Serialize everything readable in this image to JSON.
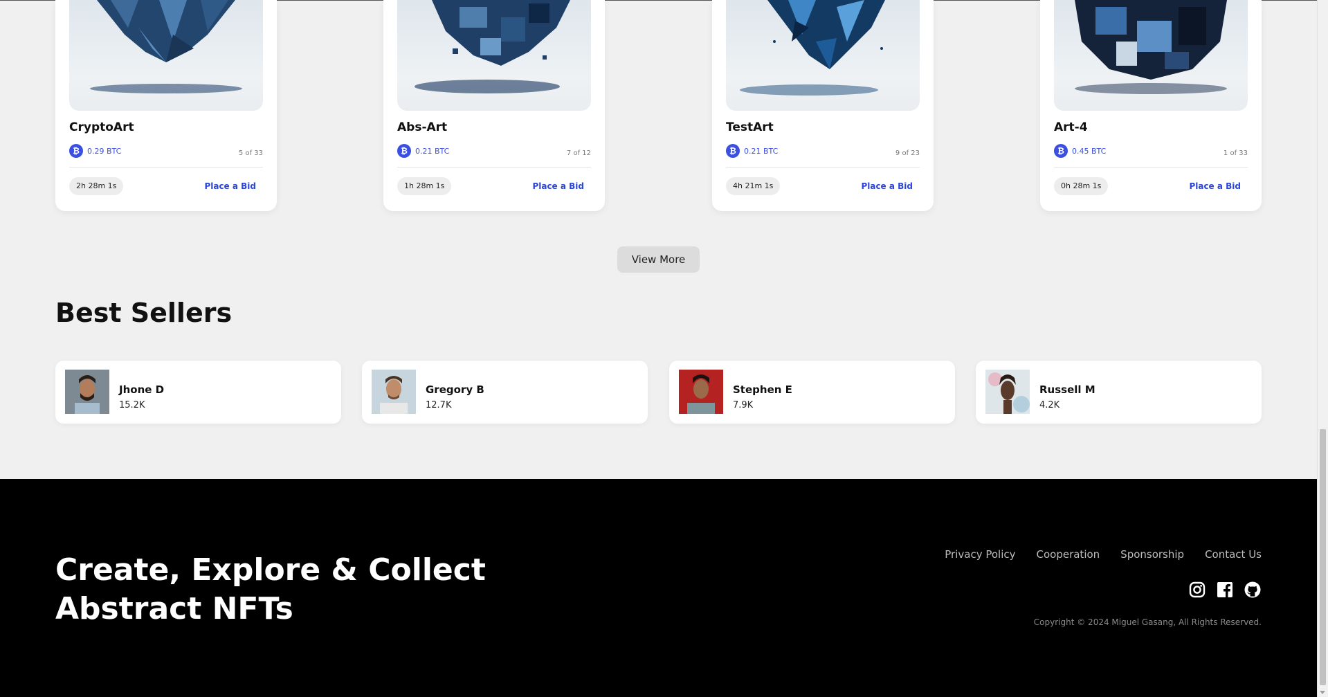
{
  "nft_cards": [
    {
      "title": "CryptoArt",
      "price": "0.29 BTC",
      "edition": "5 of 33",
      "timer": "2h 28m 1s",
      "bid_label": "Place a Bid"
    },
    {
      "title": "Abs-Art",
      "price": "0.21 BTC",
      "edition": "7 of 12",
      "timer": "1h 28m 1s",
      "bid_label": "Place a Bid"
    },
    {
      "title": "TestArt",
      "price": "0.21 BTC",
      "edition": "9 of 23",
      "timer": "4h 21m 1s",
      "bid_label": "Place a Bid"
    },
    {
      "title": "Art-4",
      "price": "0.45 BTC",
      "edition": "1 of 33",
      "timer": "0h 28m 1s",
      "bid_label": "Place a Bid"
    }
  ],
  "btc_glyph": "₿",
  "view_more_label": "View More",
  "best_sellers": {
    "title": "Best Sellers",
    "sellers": [
      {
        "name": "Jhone D",
        "sales": "15.2K"
      },
      {
        "name": "Gregory B",
        "sales": "12.7K"
      },
      {
        "name": "Stephen E",
        "sales": "7.9K"
      },
      {
        "name": "Russell M",
        "sales": "4.2K"
      }
    ]
  },
  "footer": {
    "tagline": "Create, Explore & Collect Abstract NFTs",
    "links": [
      "Privacy Policy",
      "Cooperation",
      "Sponsorship",
      "Contact Us"
    ],
    "social_icons": [
      "instagram-icon",
      "facebook-icon",
      "github-icon"
    ],
    "copyright": "Copyright © 2024 Miguel Gasang, All Rights Reserved."
  },
  "colors": {
    "accent": "#3b4fe0",
    "page_background": "#f0f0f0",
    "footer_background": "#000000"
  }
}
